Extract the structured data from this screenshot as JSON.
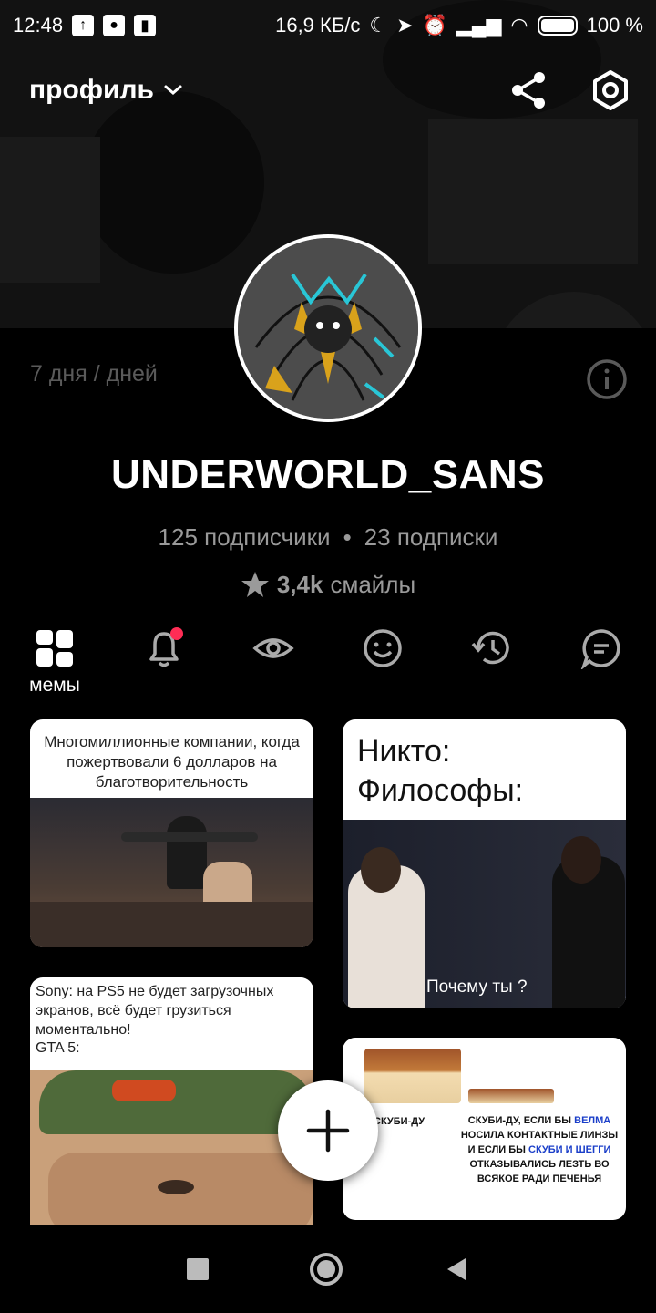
{
  "status_bar": {
    "time": "12:48",
    "speed": "16,9 КБ/с",
    "battery": "100 %"
  },
  "header": {
    "profile_label": "профиль"
  },
  "profile": {
    "days": "7 дня / дней",
    "username": "UNDERWORLD_SANS",
    "followers": "125 подписчики",
    "separator": "•",
    "following": "23 подписки",
    "smiles_count": "3,4k",
    "smiles_label": "смайлы"
  },
  "tabs": [
    {
      "icon": "grid-icon",
      "label": "мемы"
    },
    {
      "icon": "bell-icon",
      "label": ""
    },
    {
      "icon": "eye-icon",
      "label": ""
    },
    {
      "icon": "smile-icon",
      "label": ""
    },
    {
      "icon": "history-icon",
      "label": ""
    },
    {
      "icon": "chat-icon",
      "label": ""
    }
  ],
  "memes": [
    {
      "caption": "Многомиллионные компании, когда пожертвовали 6 долларов на благотворительность"
    },
    {
      "caption": "Никто:\nФилософы:",
      "subtitle": "Почему ты ?"
    },
    {
      "caption": "Sony: на PS5 не будет загрузочных экранов, всё будет грузиться моментально!\nGTA 5:"
    },
    {
      "label_left": "СКУБИ-ДУ",
      "caption_parts": [
        "СКУБИ-ДУ, ЕСЛИ БЫ ",
        "ВЕЛМА",
        " НОСИЛА КОНТАКТНЫЕ ЛИНЗЫ И ЕСЛИ БЫ ",
        "СКУБИ И ШЕГГИ",
        " ОТКАЗЫВАЛИСЬ ЛЕЗТЬ ВО ВСЯКОЕ РАДИ ПЕЧЕНЬЯ"
      ]
    }
  ],
  "colors": {
    "accent_badge": "#ff2d55",
    "blue_text": "#1a3ec9"
  }
}
